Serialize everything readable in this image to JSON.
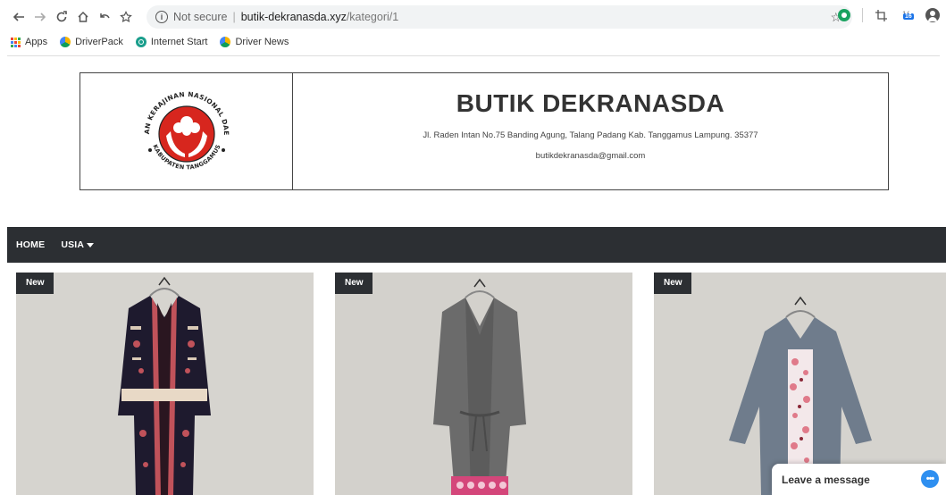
{
  "browser": {
    "url_security": "Not secure",
    "url_host": "butik-dekranasda.xyz",
    "url_path": "/kategori/1",
    "extension_badge": "16",
    "bookmarks": [
      {
        "label": "Apps"
      },
      {
        "label": "DriverPack"
      },
      {
        "label": "Internet Start"
      },
      {
        "label": "Driver News"
      }
    ]
  },
  "header": {
    "title": "BUTIK DEKRANASDA",
    "address": "Jl. Raden Intan No.75 Banding Agung, Talang Padang Kab. Tanggamus Lampung. 35377",
    "email": "butikdekranasda@gmail.com",
    "logo_text_top": "DEWAN KERAJINAN NASIONAL DAERAH",
    "logo_text_bottom": "KABUPATEN TANGGAMUS"
  },
  "nav": {
    "items": [
      {
        "label": "HOME"
      },
      {
        "label": "USIA"
      }
    ]
  },
  "products": [
    {
      "badge": "New",
      "color": "#1e1a2e",
      "accent": "#c0525a"
    },
    {
      "badge": "New",
      "color": "#6b6b6b",
      "accent": "#d4467a"
    },
    {
      "badge": "New",
      "color": "#6f7c8c",
      "accent": "#e07a8a"
    }
  ],
  "chat": {
    "label": "Leave a message"
  },
  "colors": {
    "navbar": "#2c2f33",
    "logo_red": "#d7261e",
    "chat_blue": "#2e8ff0"
  }
}
